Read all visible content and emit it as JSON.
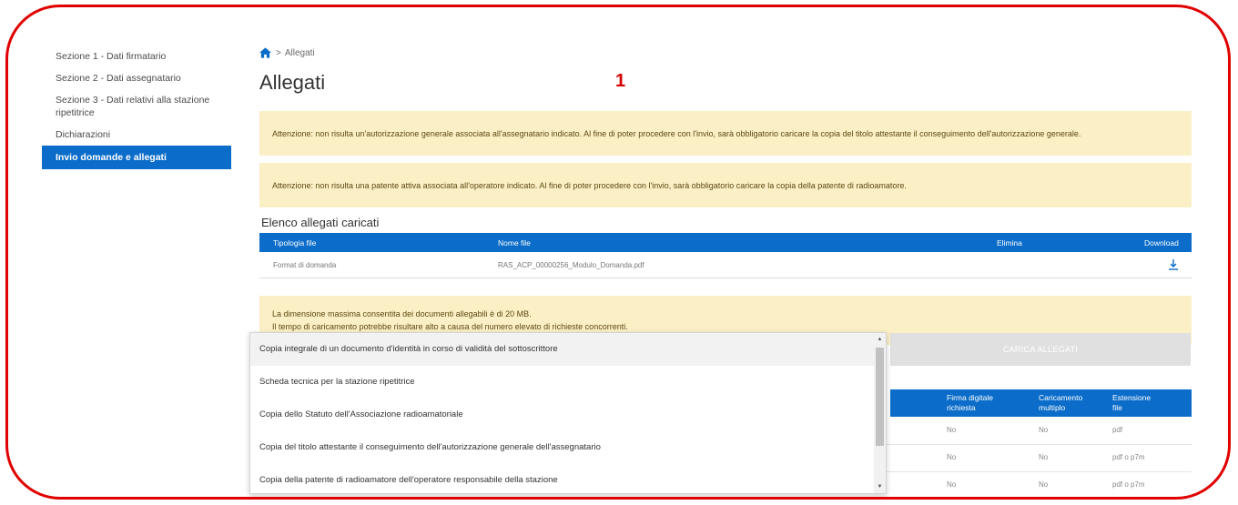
{
  "sidebar": {
    "items": [
      {
        "label": "Sezione 1 - Dati firmatario"
      },
      {
        "label": "Sezione 2 - Dati assegnatario"
      },
      {
        "label": "Sezione 3 - Dati relativi alla stazione ripetitrice"
      },
      {
        "label": "Dichiarazioni"
      },
      {
        "label": "Invio domande e allegati"
      }
    ]
  },
  "breadcrumb": {
    "current": "Allegati"
  },
  "page": {
    "title": "Allegati"
  },
  "annotation": {
    "marker": "1"
  },
  "alerts": {
    "auth": "Attenzione: non risulta un'autorizzazione generale associata all'assegnatario indicato. Al fine di poter procedere con l'invio, sarà obbligatorio caricare la copia del titolo attestante il conseguimento dell'autorizzazione generale.",
    "patent": "Attenzione: non risulta una patente attiva associata all'operatore indicato. Al fine di poter procedere con l'invio, sarà obbligatorio caricare la copia della patente di radioamatore.",
    "size_line1": "La dimensione massima consentita dei documenti allegabili è di 20 MB.",
    "size_line2": "Il tempo di caricamento potrebbe risultare alto a causa del numero elevato di richieste concorrenti."
  },
  "uploaded": {
    "title": "Elenco allegati caricati",
    "headers": {
      "type": "Tipologia file",
      "name": "Nome file",
      "delete": "Elimina",
      "download": "Download"
    },
    "rows": [
      {
        "type": "Format di domanda",
        "name": "RAS_ACP_00000256_Modulo_Domanda.pdf"
      }
    ]
  },
  "upload_button": {
    "label": "CARICA ALLEGATI"
  },
  "required": {
    "headers": {
      "signature": "Firma digitale richiesta",
      "multiple": "Caricamento multiplo",
      "extension": "Estensione file"
    },
    "rows": [
      {
        "signature": "No",
        "multiple": "No",
        "extension": "pdf"
      },
      {
        "signature": "No",
        "multiple": "No",
        "extension": "pdf o p7m"
      },
      {
        "signature": "No",
        "multiple": "No",
        "extension": "pdf o p7m"
      }
    ]
  },
  "dropdown": {
    "options": [
      "Copia integrale di un documento d'identità in corso di validità del sottoscrittore",
      "Scheda tecnica per la stazione ripetitrice",
      "Copia dello Statuto dell'Associazione radioamatoriale",
      "Copia del titolo attestante il conseguimento dell'autorizzazione generale dell'assegnatario",
      "Copia della patente di radioamatore dell'operatore responsabile della stazione"
    ]
  },
  "colors": {
    "primary": "#0b6dc9",
    "alert_bg": "#fbefc6",
    "annotation": "#e00000"
  }
}
